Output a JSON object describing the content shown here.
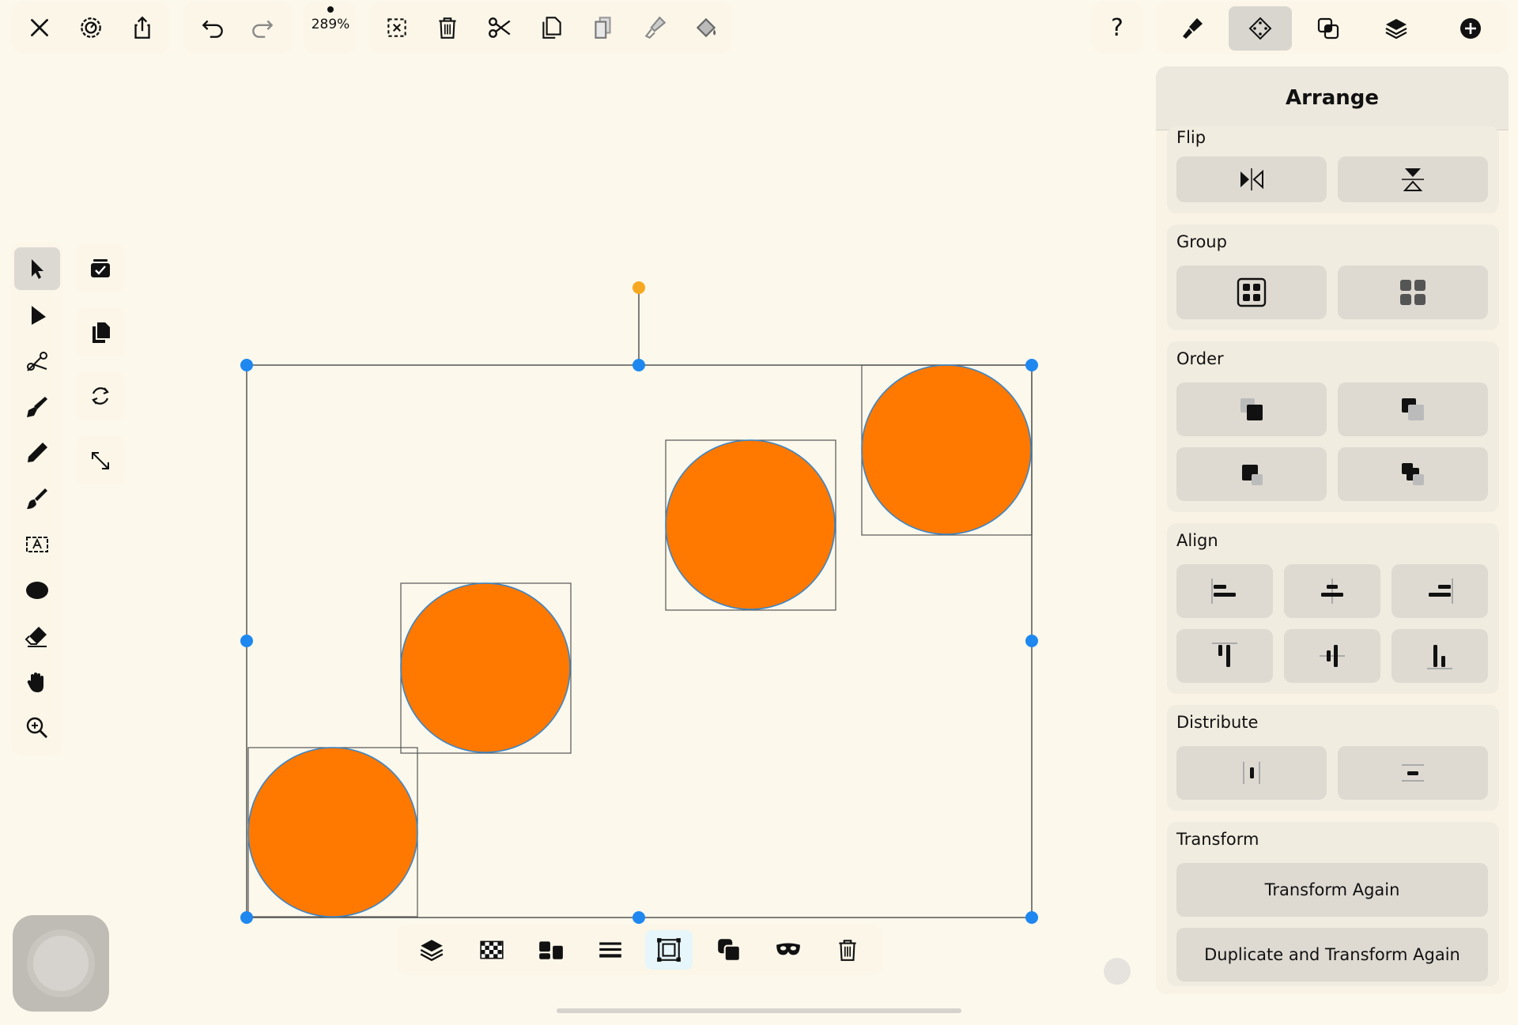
{
  "toolbar": {
    "zoom": "289%",
    "help": "?"
  },
  "right_tabs": [
    "brush-tab",
    "arrange-tab",
    "boolean-tab",
    "layers-tab",
    "add-tab"
  ],
  "panel": {
    "title": "Arrange",
    "sections": {
      "flip": "Flip",
      "group": "Group",
      "order": "Order",
      "align": "Align",
      "distribute": "Distribute",
      "transform": "Transform"
    },
    "transform_again": "Transform Again",
    "duplicate_transform_again": "Duplicate and Transform Again"
  },
  "colors": {
    "shape_fill": "#ff7800",
    "shape_stroke": "#3a86c8",
    "handle": "#1e88f0",
    "rotate_handle": "#f6a821",
    "background": "#fcf8ec"
  },
  "canvas": {
    "shapes": [
      "circle",
      "circle",
      "circle",
      "circle"
    ]
  }
}
